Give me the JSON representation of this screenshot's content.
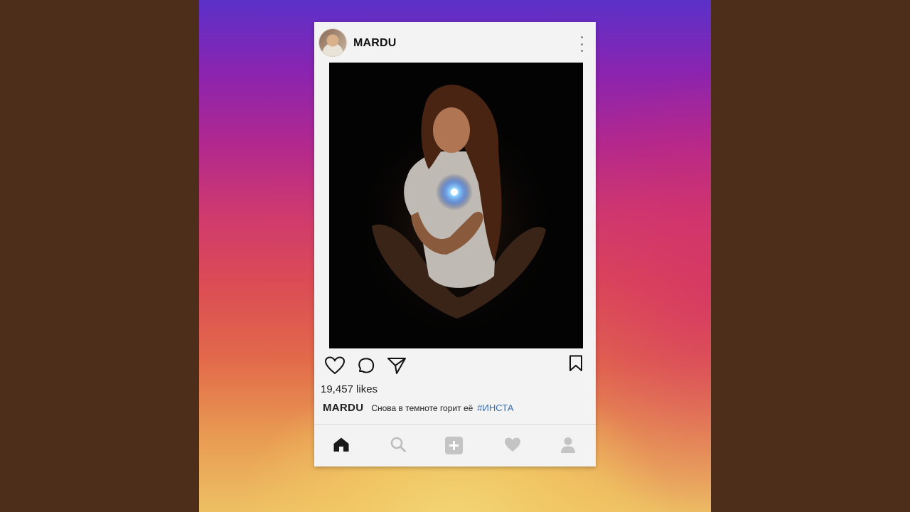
{
  "post": {
    "username": "MARDU",
    "likes": "19,457 likes",
    "caption_user": "MARDU",
    "caption_text": "Снова в темноте горит её",
    "caption_hashtag": "#ИНСТА"
  },
  "icons": {
    "header": [
      "avatar",
      "more-vertical-icon"
    ],
    "actions": [
      "heart-icon",
      "comment-icon",
      "share-icon",
      "bookmark-icon"
    ],
    "nav": [
      "home-icon",
      "search-icon",
      "add-post-icon",
      "activity-heart-icon",
      "profile-icon"
    ]
  },
  "colors": {
    "card": "#f3f3f3",
    "outer_background": "#4d2e1b",
    "hashtag": "#3b6fb0",
    "active_nav": "#1a1a1a",
    "inactive_nav": "#bdbdbd"
  }
}
